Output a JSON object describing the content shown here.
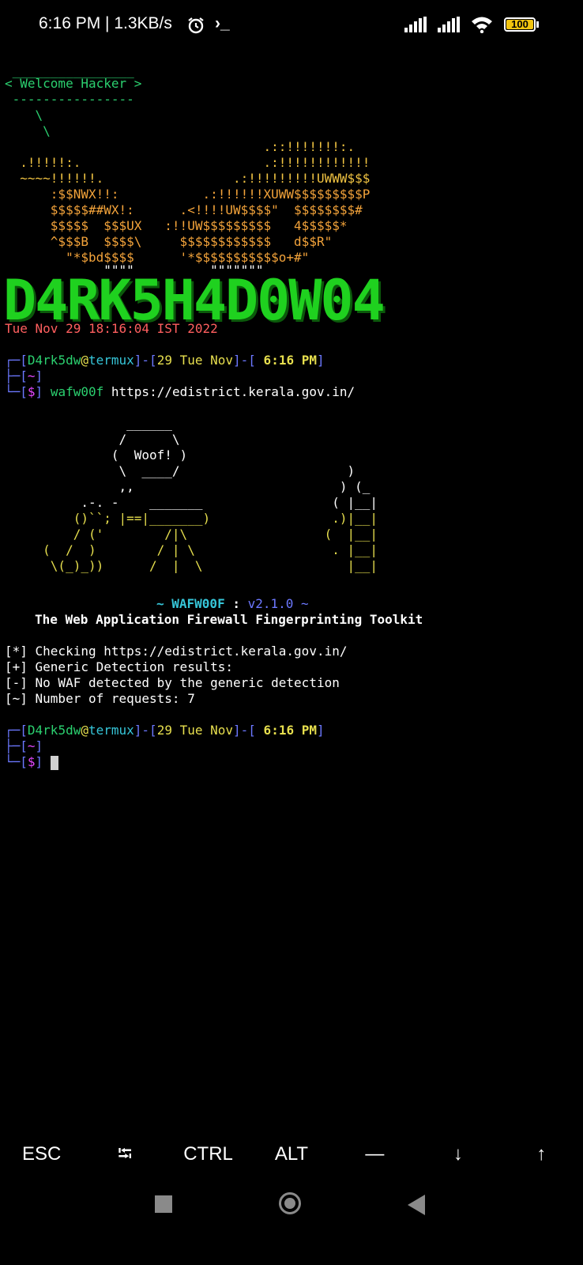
{
  "status_bar": {
    "time_text": "6:16 PM | 1.3KB/s",
    "alarm_icon": "alarm-clock-icon",
    "terminal_icon": "terminal-prompt-icon",
    "terminal_glyph": "›_",
    "battery_level": "100"
  },
  "cowsay": {
    "top_line": " ________________",
    "bubble": "< Welcome Hacker >",
    "bottom_line": " ----------------",
    "tail1": "    \\",
    "tail2": "     \\"
  },
  "ascii_art": {
    "lines": [
      "                                  .::!!!!!!!:.",
      "  .!!!!!:.                        .:!!!!!!!!!!!!",
      "  ~~~~!!!!!!.                 .:!!!!!!!!!UWWW$$$",
      "      :$$NWX!!:           .:!!!!!!XUWW$$$$$$$$$P",
      "      $$$$$##WX!:      .<!!!!UW$$$$\"  $$$$$$$$#",
      "      $$$$$  $$$UX   :!!UW$$$$$$$$$   4$$$$$*",
      "      ^$$$B  $$$$\\     $$$$$$$$$$$$   d$$R\"",
      "        \"*$bd$$$$      '*$$$$$$$$$$$o+#\"",
      "             \"\"\"\"          \"\"\"\"\"\"\""
    ]
  },
  "banner": {
    "title": "D4RK5H4D0W04",
    "date": "Tue Nov 29 18:16:04 IST 2022"
  },
  "prompt1": {
    "user": "D4rk5dw",
    "at": "@",
    "host": "termux",
    "date": "29 Tue Nov",
    "time": " 6:16 PM",
    "dir": "~",
    "symbol": "$",
    "command": "wafw00f",
    "argument": " https://edistrict.kerala.gov.in/"
  },
  "wafw00f": {
    "art": [
      "                ______",
      "               /      \\",
      "              (  Woof! )",
      "               \\  ____/                      )",
      "               ,,                           ) (_",
      "          .-. -    _______                 ( |__|",
      "         ()``; |==|_______)                .)|__|",
      "         / ('        /|\\                  (  |__|",
      "     (  /  )        / | \\                  . |__|",
      "      \\(_)_))      /  |  \\                   |__|"
    ],
    "version_prefix": "~ WAFW00F",
    "version_sep": " : ",
    "version": "v2.1.0 ~",
    "tagline": "The Web Application Firewall Fingerprinting Toolkit"
  },
  "results": [
    "[*] Checking https://edistrict.kerala.gov.in/",
    "[+] Generic Detection results:",
    "[-] No WAF detected by the generic detection",
    "[~] Number of requests: 7"
  ],
  "prompt2": {
    "user": "D4rk5dw",
    "at": "@",
    "host": "termux",
    "date": "29 Tue Nov",
    "time": " 6:16 PM",
    "dir": "~",
    "symbol": "$"
  },
  "extra_keys": [
    "ESC",
    "⭾",
    "CTRL",
    "ALT",
    "—",
    "↓",
    "↑"
  ],
  "colors": {
    "background": "#000000",
    "banner_green": "#1fd11f",
    "date_red": "#ff5f5f",
    "prompt_blue": "#6c78ff",
    "user_green": "#2bd06f",
    "symbol_magenta": "#e447ff"
  }
}
